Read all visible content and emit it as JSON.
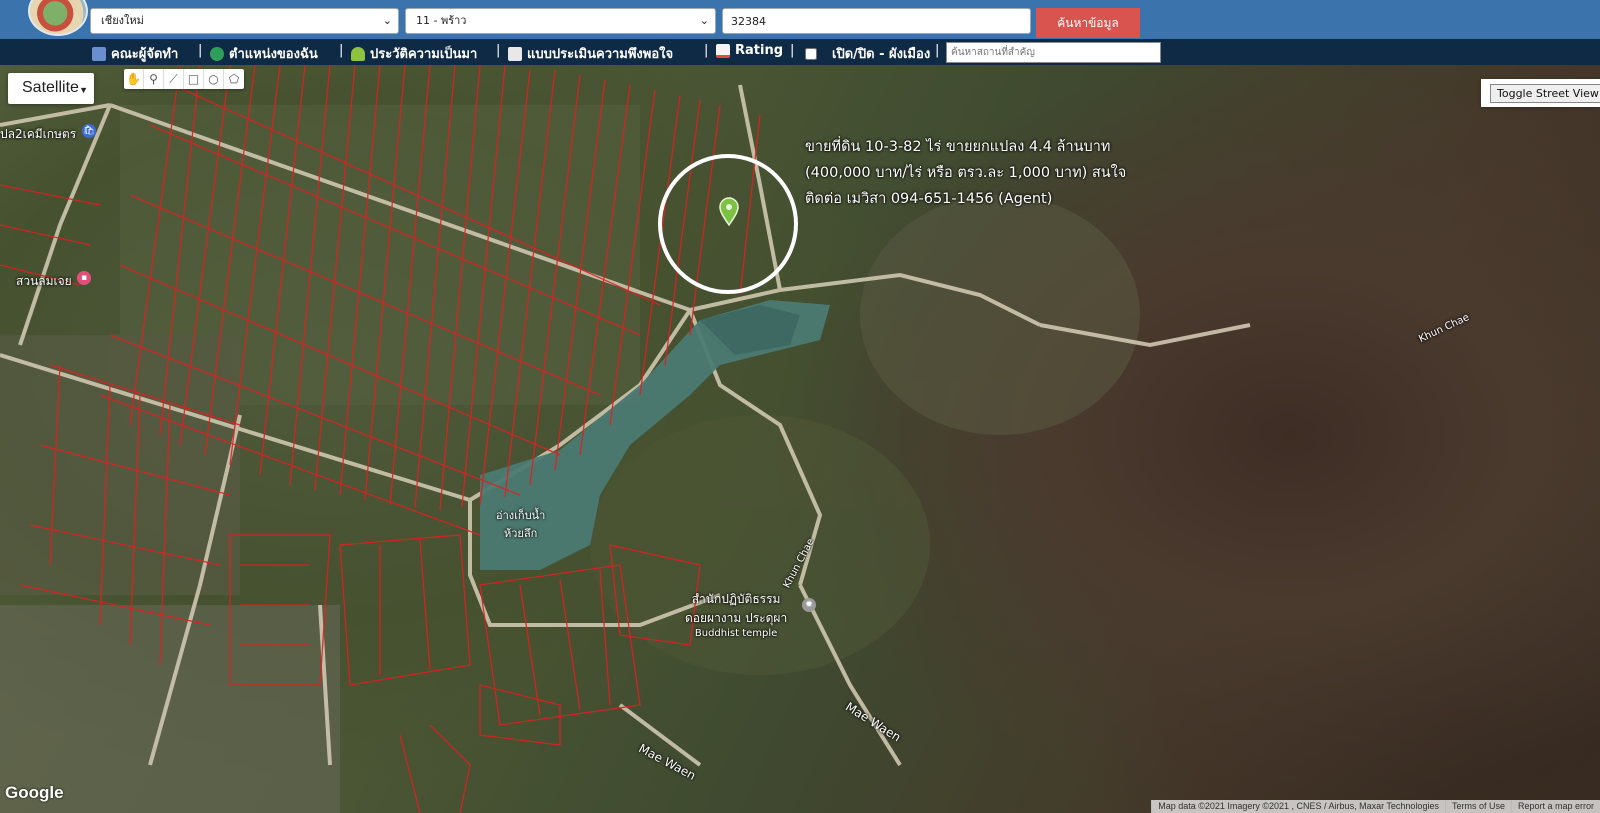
{
  "header": {
    "province_select": "เชียงใหม่",
    "district_select": "11 - พร้าว",
    "parcel_input": "32384",
    "search_button": "ค้นหาข้อมูล"
  },
  "menu": {
    "items": [
      {
        "label": "คณะผู้จัดทำ",
        "icon": "team-icon",
        "color": "#6a8fd1"
      },
      {
        "label": "ตำแหน่งของฉัน",
        "icon": "globe-icon",
        "color": "#2e9e5b"
      },
      {
        "label": "ประวัติความเป็นมา",
        "icon": "sprout-icon",
        "color": "#8fc23f"
      },
      {
        "label": "แบบประเมินความพึงพอใจ",
        "icon": "document-icon",
        "color": "#e8e8e8"
      },
      {
        "label": "Rating",
        "icon": "chart-icon",
        "color": "#e04a4a"
      },
      {
        "label": "เปิด/ปิด - ผังเมือง",
        "icon": "checkbox",
        "color": "#ffffff"
      }
    ],
    "landmark_search_placeholder": "ค้นหาสถานที่สำคัญ"
  },
  "map": {
    "map_type": "Satellite",
    "street_view_button": "Toggle Street View",
    "listing": {
      "line1": "ขายที่ดิน 10-3-82 ไร่ ขายยกแปลง 4.4 ล้านบาท",
      "line2": "(400,000 บาท/ไร่ หรือ ตรว.ละ 1,000 บาท) สนใจ",
      "line3": "ติดต่อ เมวิสา 094-651-1456 (Agent)"
    },
    "labels": {
      "poi_top_left": "ปล2เคมีเกษตร",
      "poi_left": "สวนลมเจย",
      "reservoir": "อ่างเก็บน้ำ",
      "reservoir2": "ห้วยลึก",
      "temple": "สำนักปฏิบัติธรรม",
      "temple2": "ดอยผางาม ประดุผา",
      "temple_type": "Buddhist temple",
      "road_khun_chae_1": "Khun Chae",
      "road_khun_chae_2": "Khun Chae",
      "road_mae_waen_1": "Mae Waen",
      "road_mae_waen_2": "Mae Waen"
    },
    "google_logo": "Google",
    "attribution": {
      "map_data": "Map data ©2021 Imagery ©2021 , CNES / Airbus, Maxar Technologies",
      "terms": "Terms of Use",
      "report": "Report a map error"
    },
    "colors": {
      "parcel_lines": "#e02020",
      "marker": "#7cc242"
    }
  }
}
